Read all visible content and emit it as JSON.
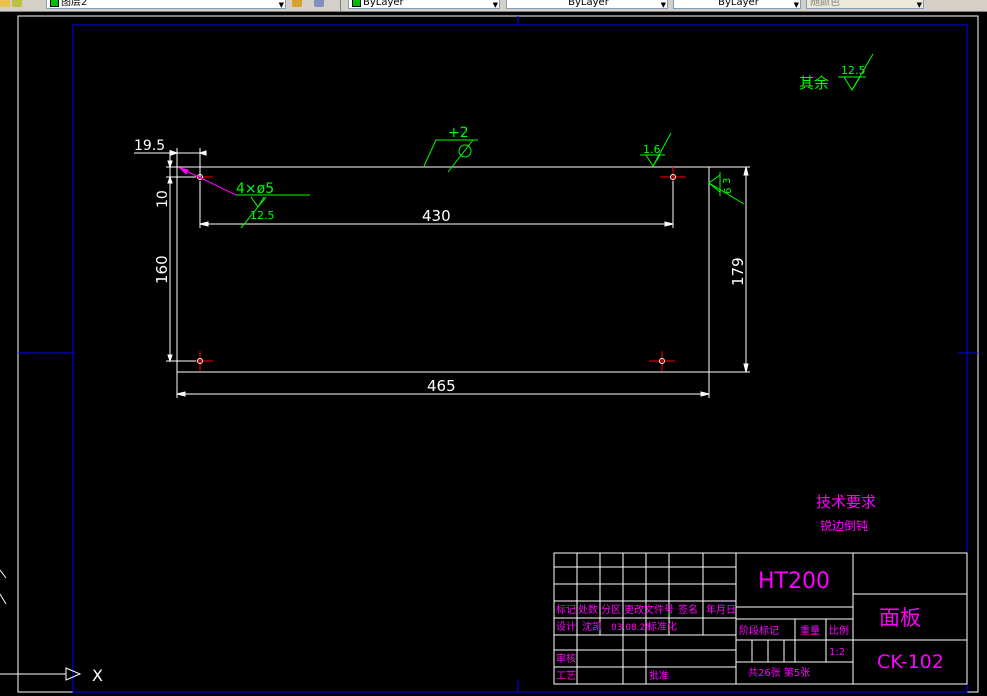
{
  "toolbar": {
    "layer_name": "图层2",
    "color_value": "ByLayer",
    "linetype_value": "ByLayer",
    "lineweight_value": "ByLayer",
    "plotstyle_value": "随颜色"
  },
  "drawing": {
    "dims": {
      "offset_x": "19.5",
      "offset_y": "10",
      "hole_spacing_x": "430",
      "hole_spacing_y": "160",
      "overall_width": "465",
      "overall_height": "179",
      "hole_callout": "4×ø5",
      "hole_roughness": "12.5"
    },
    "flatness": "+2",
    "roughness_top": "1.6",
    "roughness_right_a": "3",
    "roughness_right_b": "6",
    "roughness_other_label": "其余",
    "roughness_other_value": "12.5",
    "tech_title": "技术要求",
    "tech_note": "锐边倒钝"
  },
  "title_block": {
    "material": "HT200",
    "part_name": "面板",
    "drawing_no": "CK-102",
    "h_mark": "标记",
    "h_count": "处数",
    "h_zone": "分区",
    "h_change_doc": "更改文件号",
    "h_sign": "签名",
    "h_date": "年月日",
    "r_design": "设计",
    "r_designer": "沈凯",
    "r_date": "03.08.25",
    "r_standard": "标准化",
    "r_review": "审核",
    "r_process": "工艺",
    "r_approve": "批准",
    "stage_label": "阶段标记",
    "weight_label": "重量",
    "scale_label": "比例",
    "scale_value": "1:2",
    "sheets": "共26张 第5张"
  },
  "ucs": {
    "x_label": "X"
  },
  "colors": {
    "dim": "#ffffff",
    "annotation": "#00ff00",
    "callout": "#ff00ff",
    "frame": "#0000ff",
    "center": "#ff0000",
    "title_block": "#ff00ff"
  }
}
